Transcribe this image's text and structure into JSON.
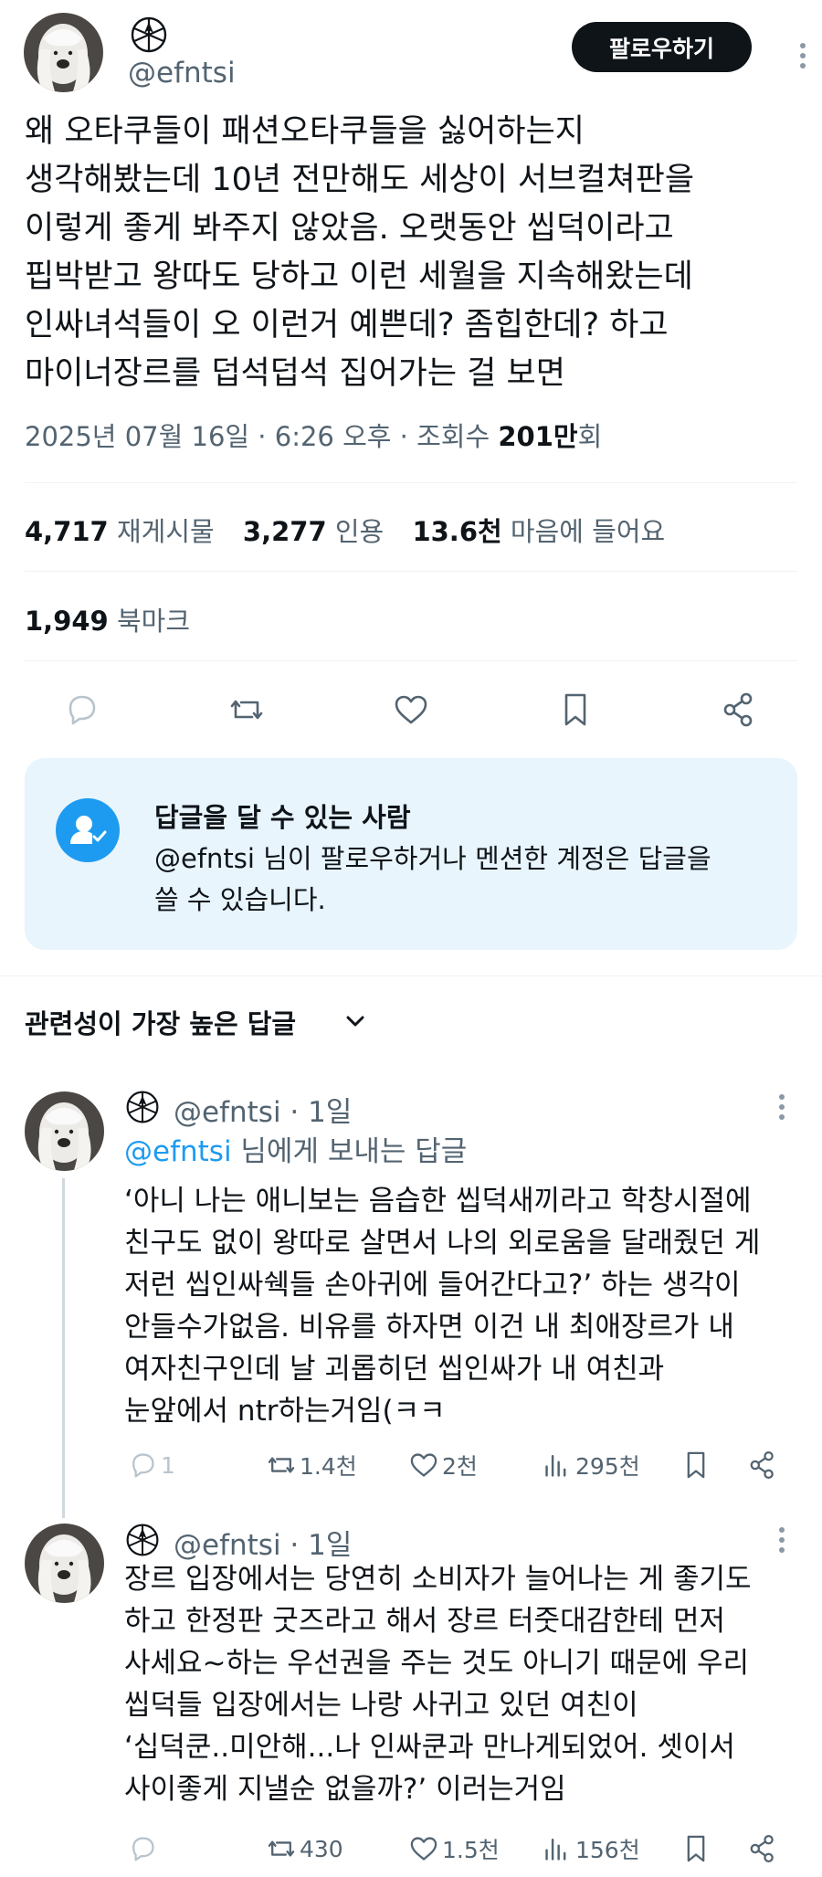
{
  "tweet": {
    "handle": "@efntsi",
    "follow_label": "팔로우하기",
    "text": "왜 오타쿠들이 패션오타쿠들을 싫어하는지\n생각해봤는데 10년 전만해도 세상이 서브컬쳐판을\n이렇게 좋게 봐주지 않았음. 오랫동안 씹덕이라고\n핍박받고 왕따도 당하고 이런 세월을 지속해왔는데\n인싸녀석들이 오 이런거 예쁜데? 좀힙한데? 하고\n마이너장르를 덥석덥석 집어가는 걸 보면",
    "date_time": "2025년 07월 16일 · 6:26 오후 · 조회수 ",
    "views_value": "201만",
    "views_suffix": "회"
  },
  "stats": {
    "reposts": "4,717",
    "reposts_label": "재게시물",
    "quotes": "3,277",
    "quotes_label": "인용",
    "likes": "13.6천",
    "likes_label": "마음에 들어요",
    "bookmarks": "1,949",
    "bookmarks_label": "북마크"
  },
  "reply_restriction": {
    "title": "답글을 달 수 있는 사람",
    "description": "@efntsi 님이 팔로우하거나 멘션한 계정은 답글을 쓸 수 있습니다."
  },
  "replies_section": {
    "title": "관련성이 가장 높은 답글"
  },
  "replies": [
    {
      "handle": "@efntsi · 1일",
      "mention_handle": "@efntsi",
      "mention_suffix": " 님에게 보내는 답글",
      "text": "‘아니 나는 애니보는 음습한 씹덕새끼라고 학창시절에\n친구도 없이 왕따로 살면서 나의 외로움을 달래줬던 게\n저런 씹인싸쉑들 손아귀에 들어간다고?’ 하는 생각이\n안들수가없음. 비유를 하자면 이건 내 최애장르가 내\n여자친구인데 날 괴롭히던 씹인싸가 내 여친과\n눈앞에서 ntr하는거임(ㅋㅋ",
      "reply_count": "1",
      "repost_count": "1.4천",
      "like_count": "2천",
      "view_count": "295천"
    },
    {
      "handle": "@efntsi · 1일",
      "text": "장르 입장에서는 당연히 소비자가 늘어나는 게 좋기도\n하고 한정판 굿즈라고 해서 장르 터줏대감한테 먼저\n사세요~하는 우선권을 주는 것도 아니기 때문에 우리\n씹덕들 입장에서는 나랑 사귀고 있던 여친이\n‘십덕쿤..미안해...나 인싸쿤과 만나게되었어. 셋이서\n사이좋게 지낼순 없을까?’ 이러는거임",
      "reply_count": "",
      "repost_count": "430",
      "like_count": "1.5천",
      "view_count": "156천"
    }
  ]
}
